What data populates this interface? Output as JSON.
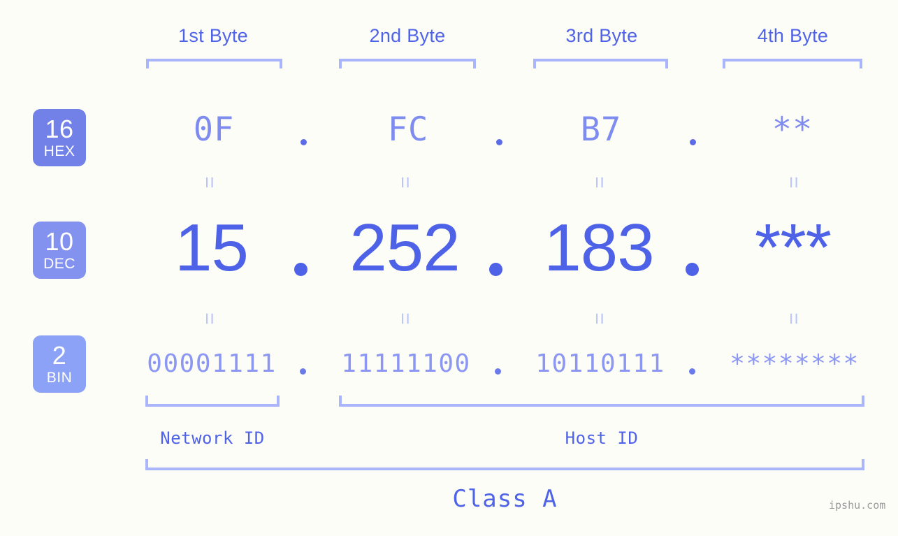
{
  "background_color": "#fdfdf8",
  "accent_colors": {
    "primary": "#4e62e8",
    "hex_text": "#7e8cf0",
    "bin_text": "#8b97f2",
    "bracket": "#aab5fb",
    "equal_mark": "#bcc5fc",
    "badge_hex": "#7181e8",
    "badge_dec": "#8392ee",
    "badge_bin": "#8ca2f7"
  },
  "byte_headers": [
    {
      "label": "1st Byte"
    },
    {
      "label": "2nd Byte"
    },
    {
      "label": "3rd Byte"
    },
    {
      "label": "4th Byte"
    }
  ],
  "rows": [
    {
      "badge_number": "16",
      "badge_name": "HEX",
      "values": [
        "0F",
        "FC",
        "B7",
        "**"
      ]
    },
    {
      "badge_number": "10",
      "badge_name": "DEC",
      "values": [
        "15",
        "252",
        "183",
        "***"
      ]
    },
    {
      "badge_number": "2",
      "badge_name": "BIN",
      "values": [
        "00001111",
        "11111100",
        "10110111",
        "********"
      ]
    }
  ],
  "separator": ".",
  "equal_mark": "=",
  "id_labels": {
    "network_id": "Network ID",
    "host_id": "Host ID"
  },
  "class_label": "Class A",
  "watermark": "ipshu.com"
}
